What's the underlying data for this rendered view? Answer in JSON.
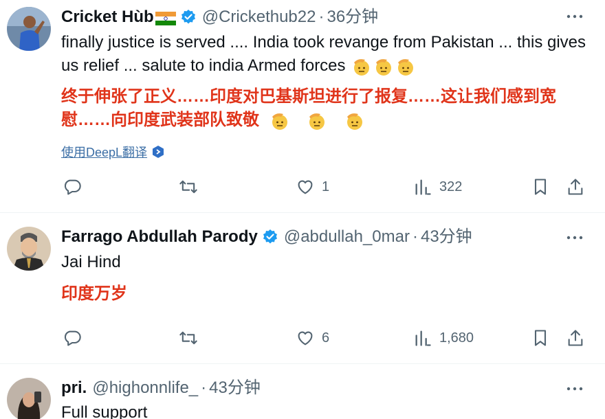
{
  "tweets": [
    {
      "name": "Cricket Hùb",
      "handle": "@Crickethub22",
      "separator": "·",
      "time": "36分钟",
      "text_en": "finally justice is served .... India took revange from Pakistan ... this gives us relief ... salute to india Armed forces",
      "text_zh": "终于伸张了正义……印度对巴基斯坦进行了报复……这让我们感到宽慰……向印度武装部队致敬",
      "translate_label": "使用DeepL翻译",
      "likes": "1",
      "views": "322"
    },
    {
      "name": "Farrago Abdullah Parody",
      "handle": "@abdullah_0mar",
      "separator": "·",
      "time": "43分钟",
      "text_en": "Jai Hind",
      "text_zh": "印度万岁",
      "likes": "6",
      "views": "1,680"
    },
    {
      "name": "pri.",
      "handle": "@highonnlife_",
      "separator": "·",
      "time": "43分钟",
      "text_en": "Full support"
    }
  ],
  "icons": [
    "reply-icon",
    "retweet-icon",
    "like-icon",
    "views-icon",
    "bookmark-icon",
    "share-icon",
    "more-icon",
    "verified-badge-icon",
    "saluting-face-icon",
    "india-flag-icon",
    "deepl-icon"
  ],
  "colors": {
    "verified": "#1d9bf0",
    "translation": "#e0341a",
    "muted": "#536471",
    "link": "#3b6ea5"
  }
}
